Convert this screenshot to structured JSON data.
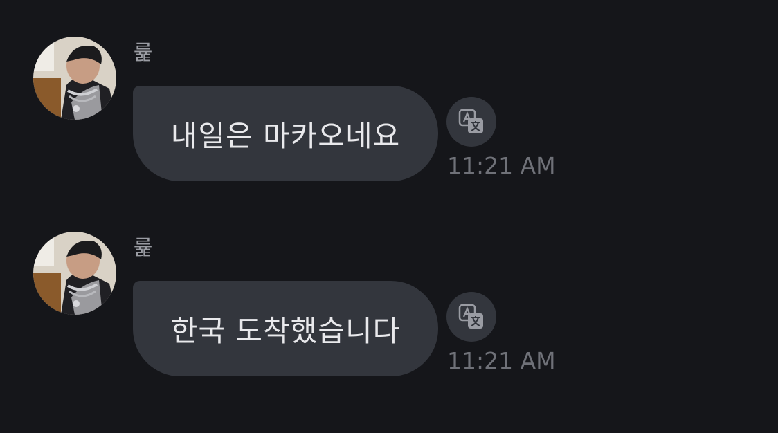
{
  "messages": [
    {
      "sender": "륥",
      "text": "내일은 마카오네요",
      "time": "11:21 AM",
      "avatar_icon": "user-photo-icon",
      "translate_icon": "translate-icon"
    },
    {
      "sender": "륥",
      "text": "한국 도착했습니다",
      "time": "11:21 AM",
      "avatar_icon": "user-photo-icon",
      "translate_icon": "translate-icon"
    }
  ],
  "colors": {
    "background": "#15161a",
    "bubble": "#33363d",
    "text": "#e9e9ec",
    "sender": "#9a9ca3",
    "timestamp": "#6f7178"
  }
}
